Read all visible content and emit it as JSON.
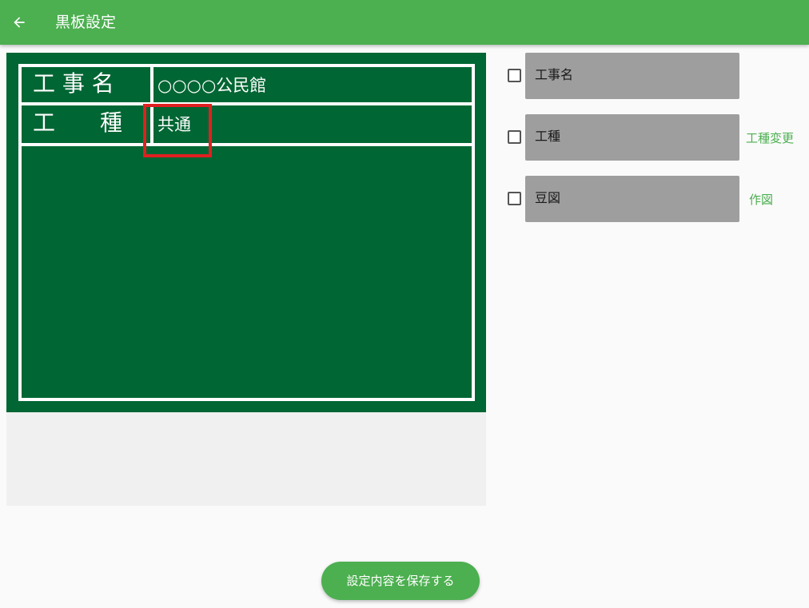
{
  "appbar": {
    "title": "黒板設定",
    "back_icon": "arrow-back-icon"
  },
  "board": {
    "rows": [
      {
        "label": "工 事 名",
        "value": "○○○○公民館"
      },
      {
        "label": "工　　種",
        "value": "共通"
      }
    ],
    "colors": {
      "board": "#006633",
      "lines": "#ffffff",
      "highlight": "#e02020"
    }
  },
  "options": [
    {
      "label": "工事名",
      "checked": false,
      "link": ""
    },
    {
      "label": "工種",
      "checked": false,
      "link": "工種変更"
    },
    {
      "label": "豆図",
      "checked": false,
      "link": "作図"
    }
  ],
  "save_button": "設定内容を保存する",
  "accent": "#4caf50"
}
